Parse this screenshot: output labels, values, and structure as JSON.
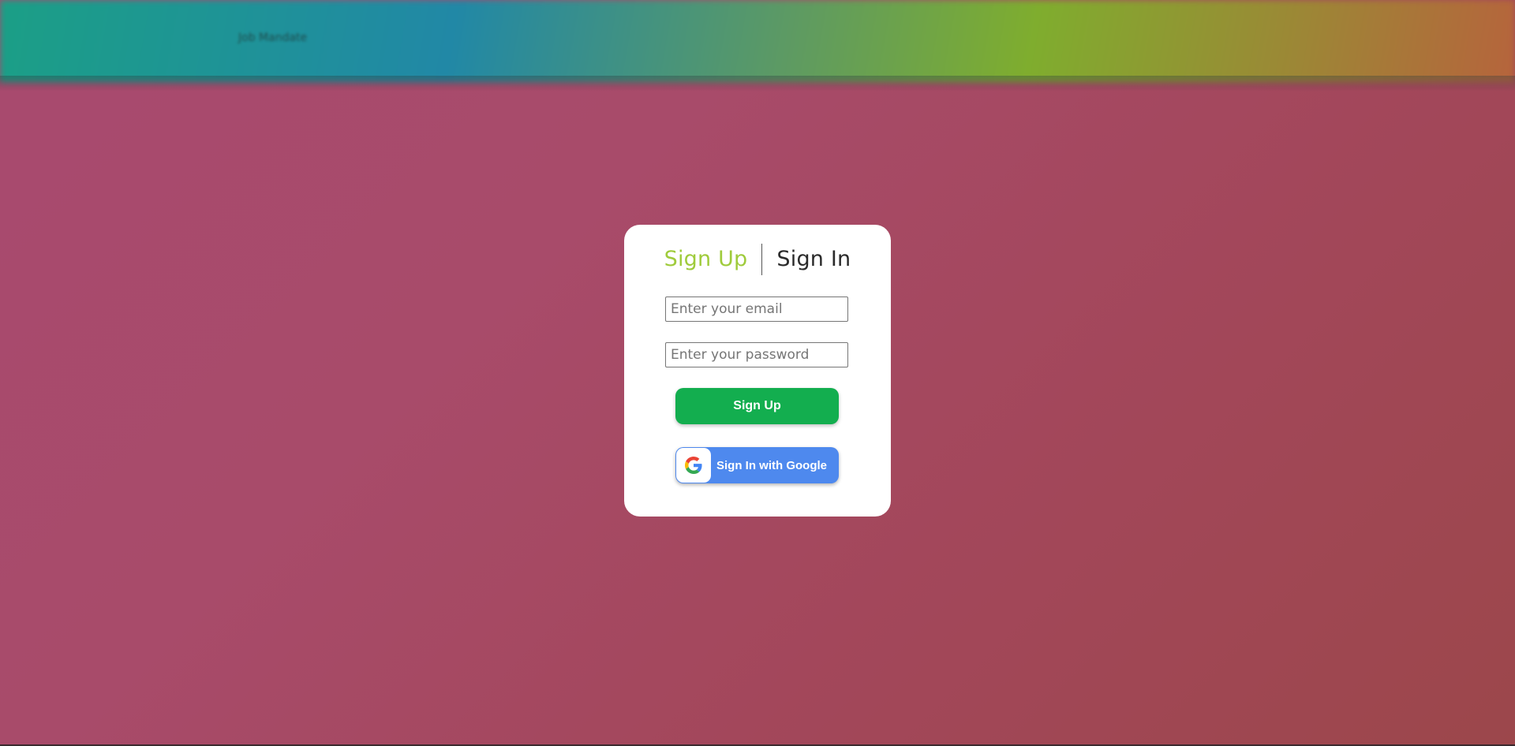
{
  "background": {
    "brand_text": "Job Mandate"
  },
  "auth": {
    "tabs": {
      "signup_label": "Sign Up",
      "signin_label": "Sign In",
      "active_color": "#9fcb3b",
      "inactive_color": "#2a2a2a"
    },
    "email": {
      "placeholder": "Enter your email",
      "value": ""
    },
    "password": {
      "placeholder": "Enter your password",
      "value": ""
    },
    "submit_label": "Sign Up",
    "submit_color": "#13ae4f",
    "google": {
      "label": "Sign In with Google",
      "icon": "google-g-icon",
      "color": "#4e89ee"
    }
  }
}
